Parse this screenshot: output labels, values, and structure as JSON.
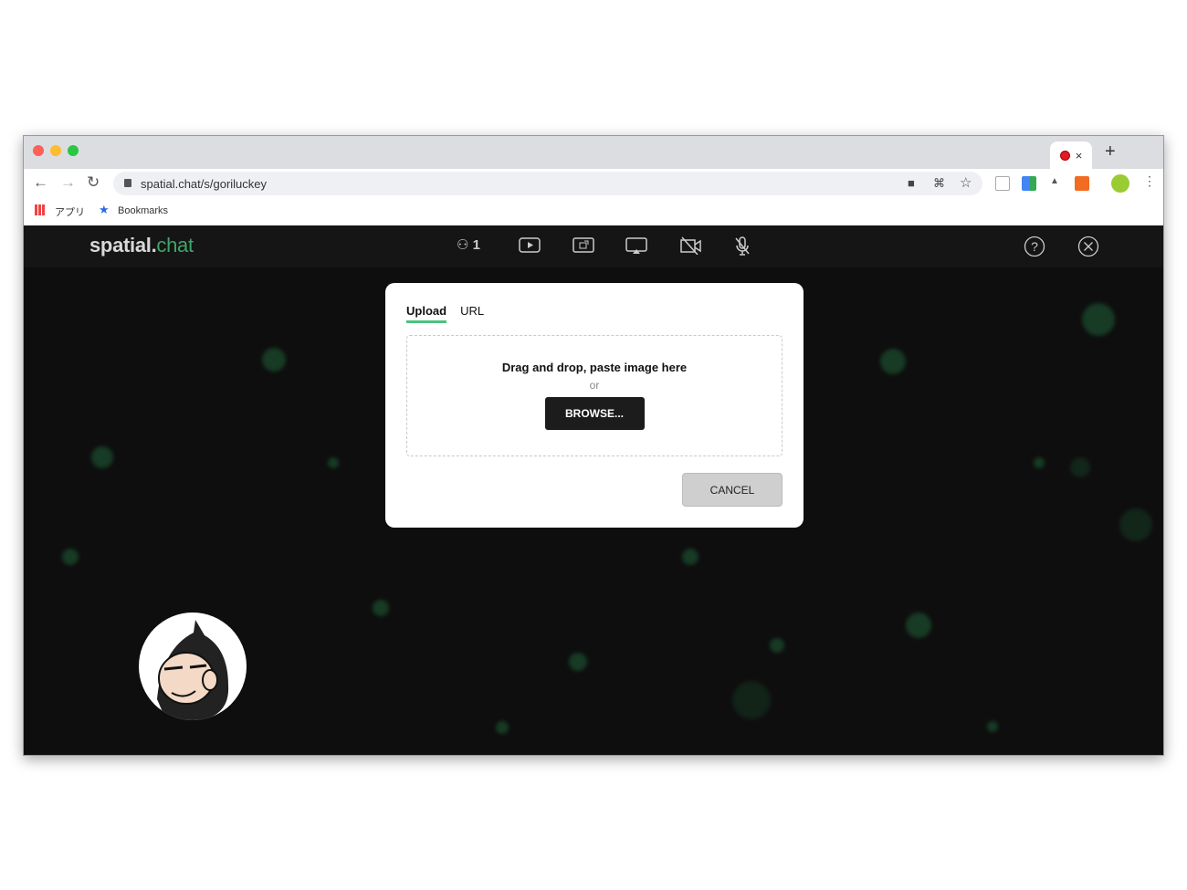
{
  "browser": {
    "url": "spatial.chat/s/goriluckey",
    "bookmarks": {
      "apps": "アプリ",
      "bookmarks": "Bookmarks"
    },
    "tab_close": "×",
    "new_tab": "+"
  },
  "app": {
    "logo_bold": "spatial.",
    "logo_light": "chat",
    "participants_count": "1",
    "accent_color": "#4cc27e"
  },
  "modal": {
    "tabs": [
      {
        "label": "Upload",
        "active": true
      },
      {
        "label": "URL",
        "active": false
      }
    ],
    "drop_text": "Drag and drop, paste image here",
    "or_text": "or",
    "browse_label": "BROWSE...",
    "cancel_label": "CANCEL"
  }
}
